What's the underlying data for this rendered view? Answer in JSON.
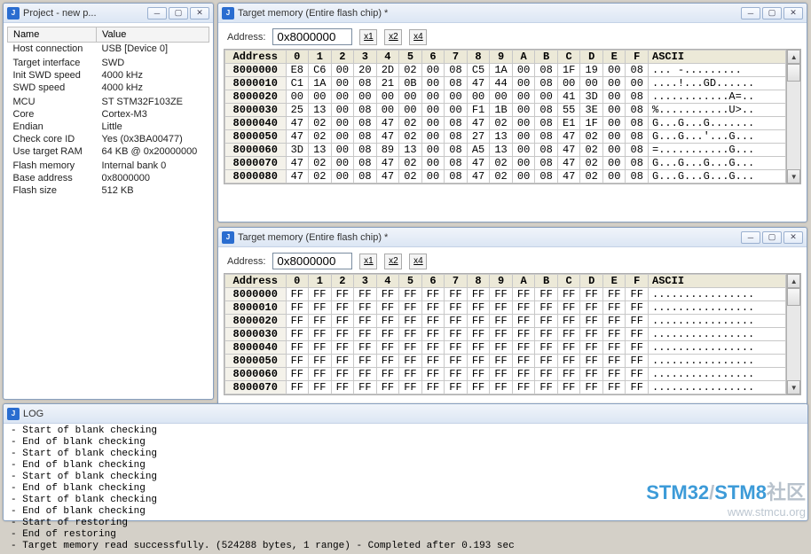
{
  "project": {
    "title": "Project - new p...",
    "headers": {
      "name": "Name",
      "value": "Value"
    },
    "rows": [
      {
        "name": "Host connection",
        "value": "USB [Device 0]"
      },
      {
        "name": "",
        "value": ""
      },
      {
        "name": "Target interface",
        "value": "SWD"
      },
      {
        "name": "Init SWD speed",
        "value": "4000 kHz"
      },
      {
        "name": "SWD speed",
        "value": "4000 kHz"
      },
      {
        "name": "",
        "value": ""
      },
      {
        "name": "MCU",
        "value": "ST STM32F103ZE"
      },
      {
        "name": "Core",
        "value": "Cortex-M3"
      },
      {
        "name": "Endian",
        "value": "Little"
      },
      {
        "name": "Check core ID",
        "value": "Yes (0x3BA00477)"
      },
      {
        "name": "Use target RAM",
        "value": "64 KB @ 0x20000000"
      },
      {
        "name": "",
        "value": ""
      },
      {
        "name": "Flash memory",
        "value": "Internal bank 0"
      },
      {
        "name": "Base address",
        "value": "0x8000000"
      },
      {
        "name": "Flash size",
        "value": "512 KB"
      }
    ]
  },
  "memTop": {
    "title": "Target memory (Entire flash chip) *",
    "addressLabel": "Address:",
    "addressValue": "0x8000000",
    "zoom": {
      "x1": "x1",
      "x2": "x2",
      "x4": "x4"
    },
    "headers": [
      "Address",
      "0",
      "1",
      "2",
      "3",
      "4",
      "5",
      "6",
      "7",
      "8",
      "9",
      "A",
      "B",
      "C",
      "D",
      "E",
      "F",
      "ASCII"
    ],
    "rows": [
      {
        "a": "8000000",
        "b": [
          "E8",
          "C6",
          "00",
          "20",
          "2D",
          "02",
          "00",
          "08",
          "C5",
          "1A",
          "00",
          "08",
          "1F",
          "19",
          "00",
          "08"
        ],
        "asc": "... -........."
      },
      {
        "a": "8000010",
        "b": [
          "C1",
          "1A",
          "00",
          "08",
          "21",
          "0B",
          "00",
          "08",
          "47",
          "44",
          "00",
          "08",
          "00",
          "00",
          "00",
          "00"
        ],
        "asc": "....!...GD......"
      },
      {
        "a": "8000020",
        "b": [
          "00",
          "00",
          "00",
          "00",
          "00",
          "00",
          "00",
          "00",
          "00",
          "00",
          "00",
          "00",
          "41",
          "3D",
          "00",
          "08"
        ],
        "asc": "............A=.."
      },
      {
        "a": "8000030",
        "b": [
          "25",
          "13",
          "00",
          "08",
          "00",
          "00",
          "00",
          "00",
          "F1",
          "1B",
          "00",
          "08",
          "55",
          "3E",
          "00",
          "08"
        ],
        "asc": "%...........U>.."
      },
      {
        "a": "8000040",
        "b": [
          "47",
          "02",
          "00",
          "08",
          "47",
          "02",
          "00",
          "08",
          "47",
          "02",
          "00",
          "08",
          "E1",
          "1F",
          "00",
          "08"
        ],
        "asc": "G...G...G......."
      },
      {
        "a": "8000050",
        "b": [
          "47",
          "02",
          "00",
          "08",
          "47",
          "02",
          "00",
          "08",
          "27",
          "13",
          "00",
          "08",
          "47",
          "02",
          "00",
          "08"
        ],
        "asc": "G...G...'...G..."
      },
      {
        "a": "8000060",
        "b": [
          "3D",
          "13",
          "00",
          "08",
          "89",
          "13",
          "00",
          "08",
          "A5",
          "13",
          "00",
          "08",
          "47",
          "02",
          "00",
          "08"
        ],
        "asc": "=...........G..."
      },
      {
        "a": "8000070",
        "b": [
          "47",
          "02",
          "00",
          "08",
          "47",
          "02",
          "00",
          "08",
          "47",
          "02",
          "00",
          "08",
          "47",
          "02",
          "00",
          "08"
        ],
        "asc": "G...G...G...G..."
      },
      {
        "a": "8000080",
        "b": [
          "47",
          "02",
          "00",
          "08",
          "47",
          "02",
          "00",
          "08",
          "47",
          "02",
          "00",
          "08",
          "47",
          "02",
          "00",
          "08"
        ],
        "asc": "G...G...G...G..."
      }
    ]
  },
  "memBot": {
    "title": "Target memory (Entire flash chip) *",
    "addressLabel": "Address:",
    "addressValue": "0x8000000",
    "headers": [
      "Address",
      "0",
      "1",
      "2",
      "3",
      "4",
      "5",
      "6",
      "7",
      "8",
      "9",
      "A",
      "B",
      "C",
      "D",
      "E",
      "F",
      "ASCII"
    ],
    "rows": [
      {
        "a": "8000000",
        "b": [
          "FF",
          "FF",
          "FF",
          "FF",
          "FF",
          "FF",
          "FF",
          "FF",
          "FF",
          "FF",
          "FF",
          "FF",
          "FF",
          "FF",
          "FF",
          "FF"
        ],
        "asc": "................"
      },
      {
        "a": "8000010",
        "b": [
          "FF",
          "FF",
          "FF",
          "FF",
          "FF",
          "FF",
          "FF",
          "FF",
          "FF",
          "FF",
          "FF",
          "FF",
          "FF",
          "FF",
          "FF",
          "FF"
        ],
        "asc": "................"
      },
      {
        "a": "8000020",
        "b": [
          "FF",
          "FF",
          "FF",
          "FF",
          "FF",
          "FF",
          "FF",
          "FF",
          "FF",
          "FF",
          "FF",
          "FF",
          "FF",
          "FF",
          "FF",
          "FF"
        ],
        "asc": "................"
      },
      {
        "a": "8000030",
        "b": [
          "FF",
          "FF",
          "FF",
          "FF",
          "FF",
          "FF",
          "FF",
          "FF",
          "FF",
          "FF",
          "FF",
          "FF",
          "FF",
          "FF",
          "FF",
          "FF"
        ],
        "asc": "................"
      },
      {
        "a": "8000040",
        "b": [
          "FF",
          "FF",
          "FF",
          "FF",
          "FF",
          "FF",
          "FF",
          "FF",
          "FF",
          "FF",
          "FF",
          "FF",
          "FF",
          "FF",
          "FF",
          "FF"
        ],
        "asc": "................"
      },
      {
        "a": "8000050",
        "b": [
          "FF",
          "FF",
          "FF",
          "FF",
          "FF",
          "FF",
          "FF",
          "FF",
          "FF",
          "FF",
          "FF",
          "FF",
          "FF",
          "FF",
          "FF",
          "FF"
        ],
        "asc": "................"
      },
      {
        "a": "8000060",
        "b": [
          "FF",
          "FF",
          "FF",
          "FF",
          "FF",
          "FF",
          "FF",
          "FF",
          "FF",
          "FF",
          "FF",
          "FF",
          "FF",
          "FF",
          "FF",
          "FF"
        ],
        "asc": "................"
      },
      {
        "a": "8000070",
        "b": [
          "FF",
          "FF",
          "FF",
          "FF",
          "FF",
          "FF",
          "FF",
          "FF",
          "FF",
          "FF",
          "FF",
          "FF",
          "FF",
          "FF",
          "FF",
          "FF"
        ],
        "asc": "................"
      }
    ]
  },
  "log": {
    "title": "LOG",
    "lines": [
      " - Start of blank checking",
      " - End of blank checking",
      " - Start of blank checking",
      " - End of blank checking",
      " - Start of blank checking",
      " - End of blank checking",
      " - Start of blank checking",
      " - End of blank checking",
      " - Start of restoring",
      " - End of restoring",
      " - Target memory read successfully.  (524288 bytes, 1 range) - Completed after 0.193 sec"
    ]
  },
  "watermark": {
    "a": "STM32",
    "b": "/",
    "c": "STM8",
    "d": "社区",
    "url": "www.stmcu.org"
  },
  "icons": {
    "min": "─",
    "max": "▢",
    "close": "✕"
  }
}
